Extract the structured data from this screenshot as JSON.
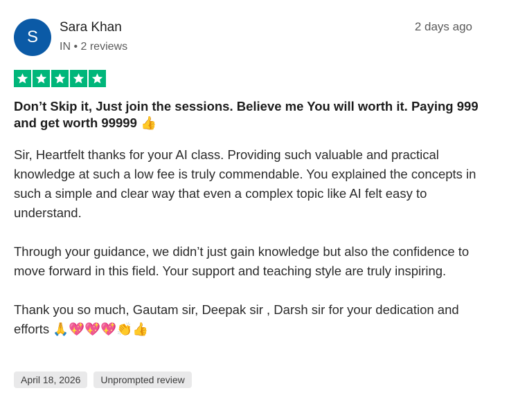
{
  "reviewer": {
    "avatar_initial": "S",
    "avatar_color": "#0b5aa6",
    "name": "Sara Khan",
    "meta": "IN • 2 reviews"
  },
  "review": {
    "date_relative": "2 days ago",
    "rating": 5,
    "rating_max": 5,
    "star_color": "#00b67a",
    "title": "Don’t Skip it, Just join the sessions. Believe me You will worth it. Paying 999 and get worth 99999 👍",
    "paragraphs": [
      "Sir, Heartfelt thanks for your AI class. Providing such valuable and practical knowledge at such a low fee is truly commendable. You explained the concepts in such a simple and clear way that even a complex topic like AI felt easy to understand.",
      "Through your guidance, we didn’t just gain knowledge but also the confidence to move forward in this field. Your support and teaching style are truly inspiring.",
      "Thank you so much, Gautam sir, Deepak sir , Darsh sir for your dedication and efforts 🙏💖💖💖👏👍"
    ],
    "tags": [
      "April 18, 2026",
      "Unprompted review"
    ]
  }
}
